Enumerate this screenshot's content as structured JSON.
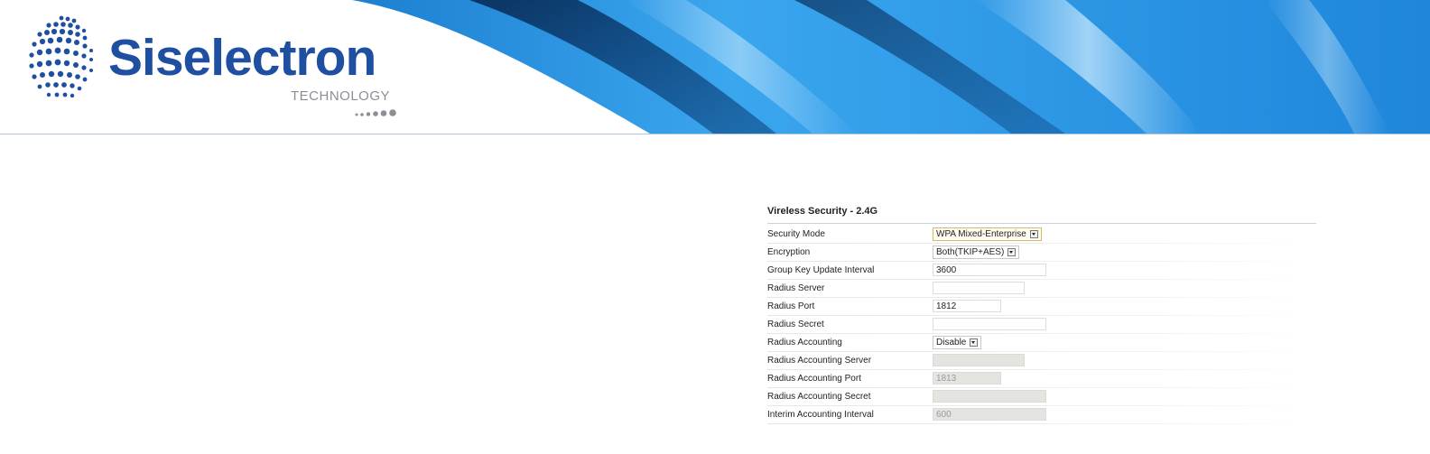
{
  "brand": {
    "name": "Siselectron",
    "tagline": "TECHNOLOGY"
  },
  "colors": {
    "brand_blue": "#1f4fa0",
    "banner_blue": "#2a9be6",
    "banner_dark": "#0b3a6e"
  },
  "form": {
    "title": "Vireless Security - 2.4G",
    "rows": [
      {
        "label": "Security Mode",
        "type": "select",
        "value": "WPA Mixed-Enterprise",
        "disabled": false
      },
      {
        "label": "Encryption",
        "type": "select",
        "value": "Both(TKIP+AES)",
        "disabled": false
      },
      {
        "label": "Group Key Update Interval",
        "type": "text",
        "value": "3600",
        "disabled": false
      },
      {
        "label": "Radius Server",
        "type": "text",
        "value": "",
        "disabled": false
      },
      {
        "label": "Radius Port",
        "type": "text",
        "value": "1812",
        "disabled": false
      },
      {
        "label": "Radius Secret",
        "type": "text",
        "value": "",
        "disabled": false
      },
      {
        "label": "Radius Accounting",
        "type": "select",
        "value": "Disable",
        "disabled": false
      },
      {
        "label": "Radius Accounting Server",
        "type": "text",
        "value": "",
        "disabled": true
      },
      {
        "label": "Radius Accounting Port",
        "type": "text",
        "value": "1813",
        "disabled": true
      },
      {
        "label": "Radius Accounting Secret",
        "type": "text",
        "value": "",
        "disabled": true
      },
      {
        "label": "Interim Accounting Interval",
        "type": "text",
        "value": "600",
        "disabled": true
      }
    ]
  }
}
